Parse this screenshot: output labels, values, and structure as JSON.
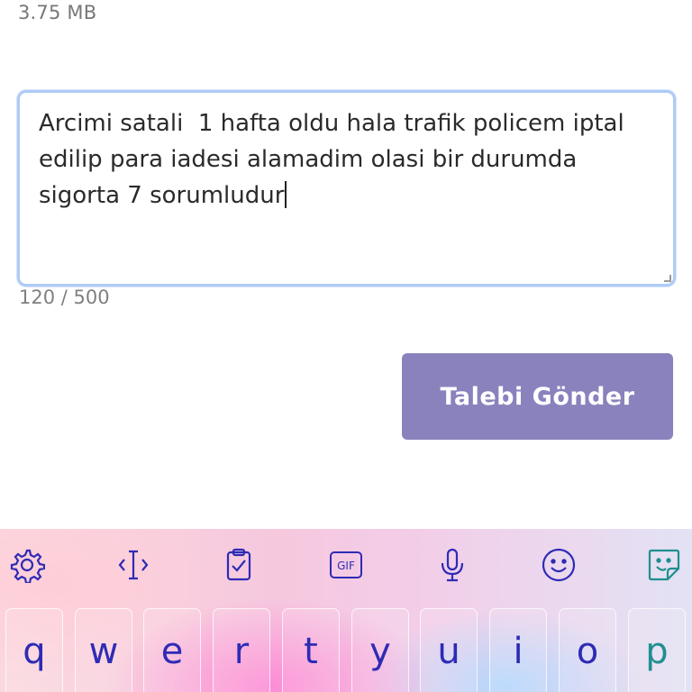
{
  "attachment": {
    "size": "3.75 MB"
  },
  "message": {
    "text": "Arcimi satali  1 hafta oldu hala trafik policem iptal edilip para iadesi alamadim olasi bir durumda sigorta 7 sorumludur",
    "counter": "120 / 500"
  },
  "submit": {
    "label": "Talebi Gönder",
    "color": "#8a82bd"
  },
  "keyboard": {
    "toolbar": [
      "gear-icon",
      "cursor-icon",
      "clipboard-icon",
      "gif-icon",
      "microphone-icon",
      "emoji-icon",
      "sticker-icon"
    ],
    "gif_label": "GIF",
    "keys": [
      "q",
      "w",
      "e",
      "r",
      "t",
      "y",
      "u",
      "i",
      "o",
      "p"
    ],
    "accent": "#2e2bb5",
    "accent_alt": "#1f8f8f"
  }
}
